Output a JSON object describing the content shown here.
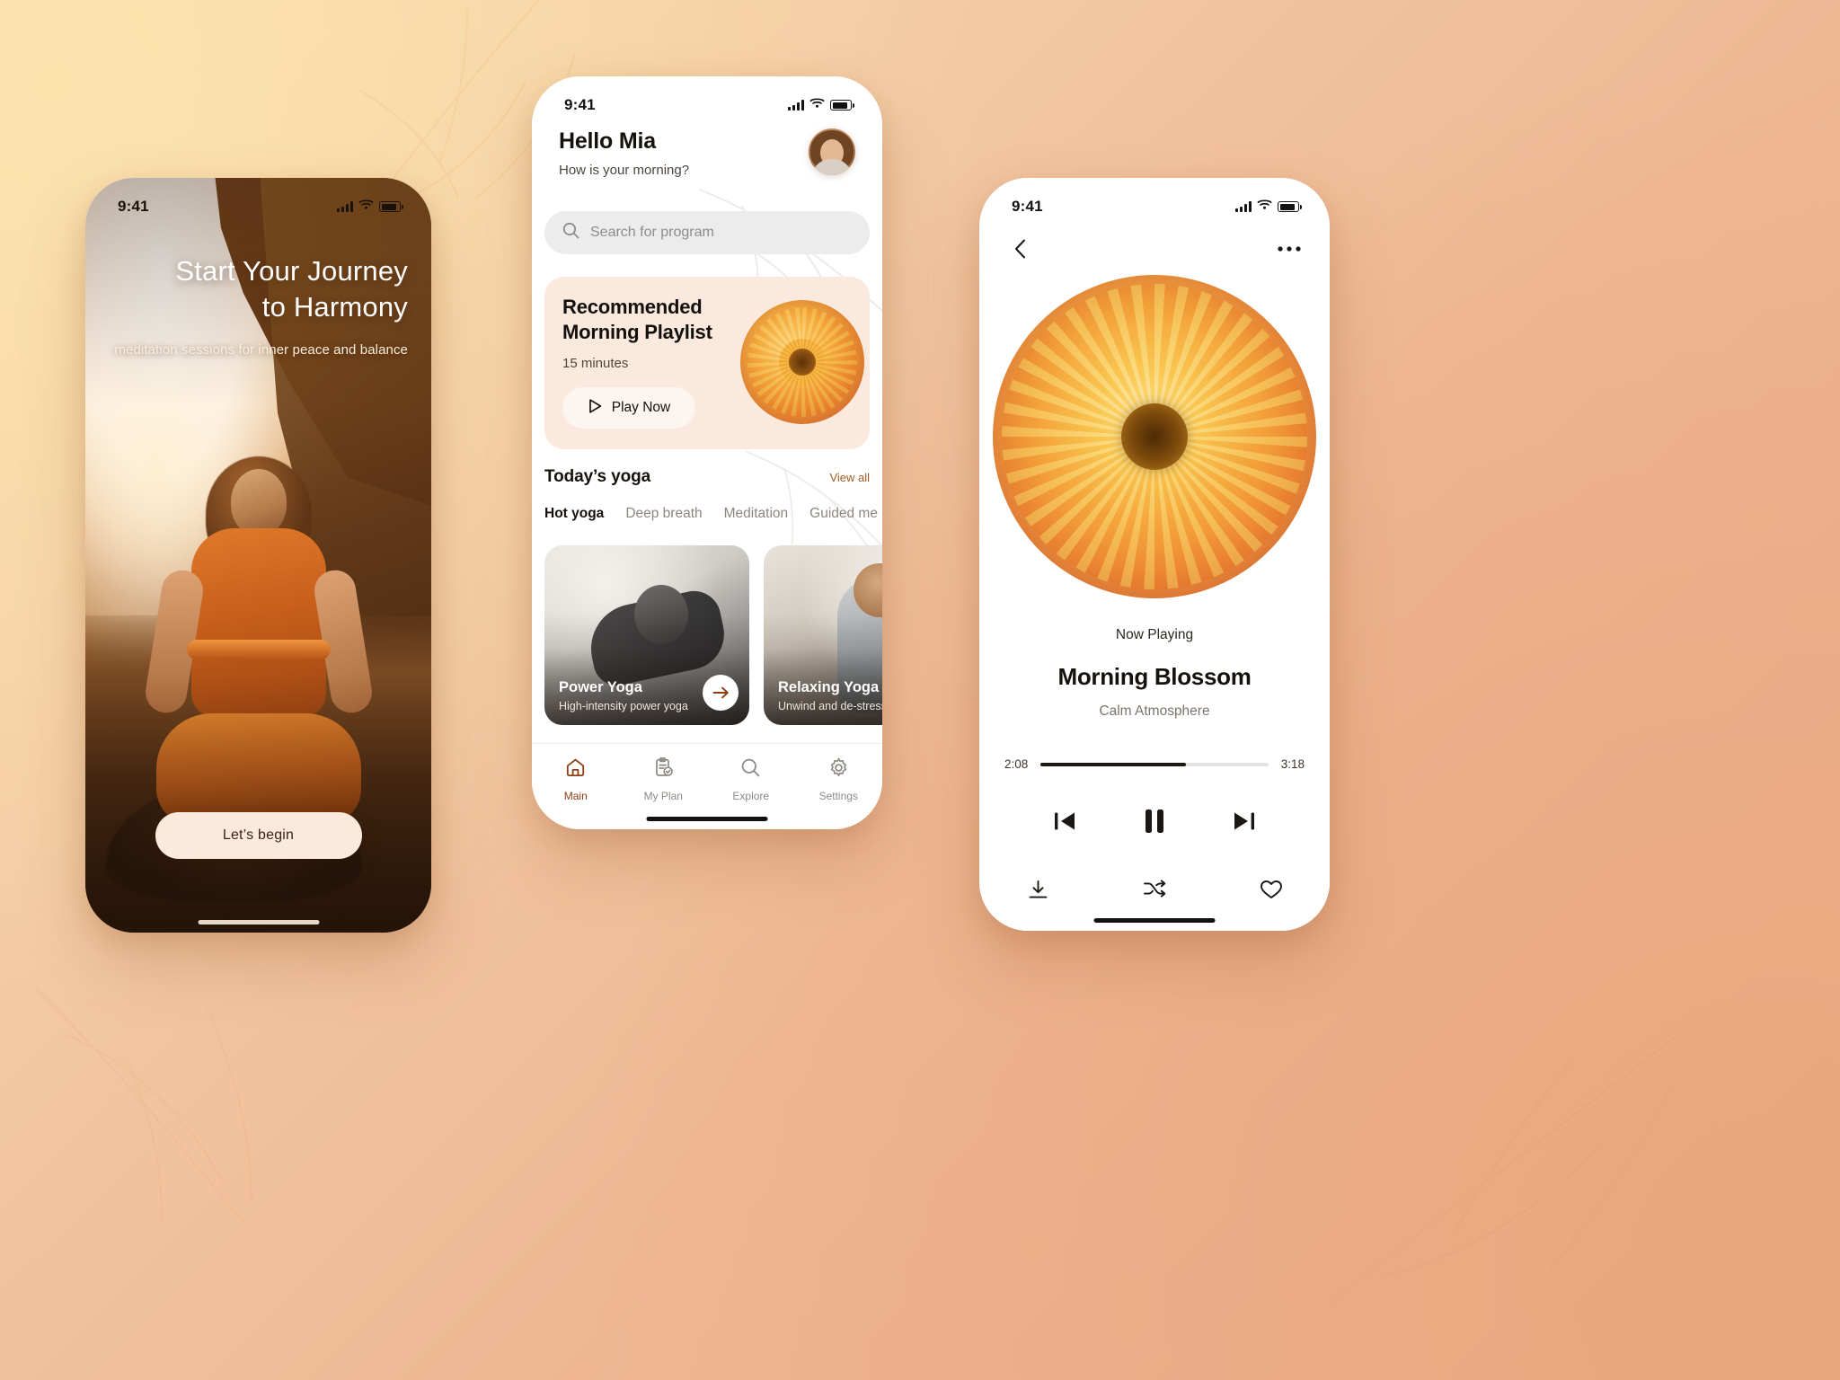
{
  "background": {
    "accent": "#a35a22",
    "surface": "#fbe9de",
    "page_gradient_start": "#f7d9a8",
    "page_gradient_end": "#e9a98a"
  },
  "onboarding": {
    "status": {
      "time": "9:41"
    },
    "title_line1": "Start Your Journey",
    "title_line2": "to Harmony",
    "subtitle": "meditation sessions for inner peace and balance",
    "cta": "Let’s begin"
  },
  "home": {
    "status": {
      "time": "9:41"
    },
    "greeting_name": "Hello Mia",
    "greeting_question": "How is your morning?",
    "search": {
      "placeholder": "Search for program"
    },
    "recommended": {
      "title_line1": "Recommended",
      "title_line2": "Morning Playlist",
      "duration": "15 minutes",
      "play_label": "Play Now"
    },
    "section": {
      "title": "Today’s yoga",
      "view_all": "View all"
    },
    "tabs": [
      {
        "label": "Hot yoga",
        "active": true
      },
      {
        "label": "Deep breath",
        "active": false
      },
      {
        "label": "Meditation",
        "active": false
      },
      {
        "label": "Guided me",
        "active": false
      }
    ],
    "cards": [
      {
        "title": "Power Yoga",
        "desc": "High-intensity power yoga"
      },
      {
        "title": "Relaxing Yoga",
        "desc": "Unwind and de-stress"
      }
    ],
    "nav": [
      {
        "label": "Main",
        "icon": "home-icon",
        "active": true
      },
      {
        "label": "My Plan",
        "icon": "clipboard-check-icon",
        "active": false
      },
      {
        "label": "Explore",
        "icon": "search-icon",
        "active": false
      },
      {
        "label": "Settings",
        "icon": "gear-icon",
        "active": false
      }
    ]
  },
  "player": {
    "status": {
      "time": "9:41"
    },
    "now_playing": "Now Playing",
    "track_title": "Morning Blossom",
    "track_artist": "Calm Atmosphere",
    "elapsed": "2:08",
    "duration": "3:18",
    "progress_percent": 64,
    "controls": [
      "previous-icon",
      "pause-icon",
      "next-icon"
    ],
    "extras": [
      "download-icon",
      "shuffle-icon",
      "heart-icon"
    ]
  }
}
